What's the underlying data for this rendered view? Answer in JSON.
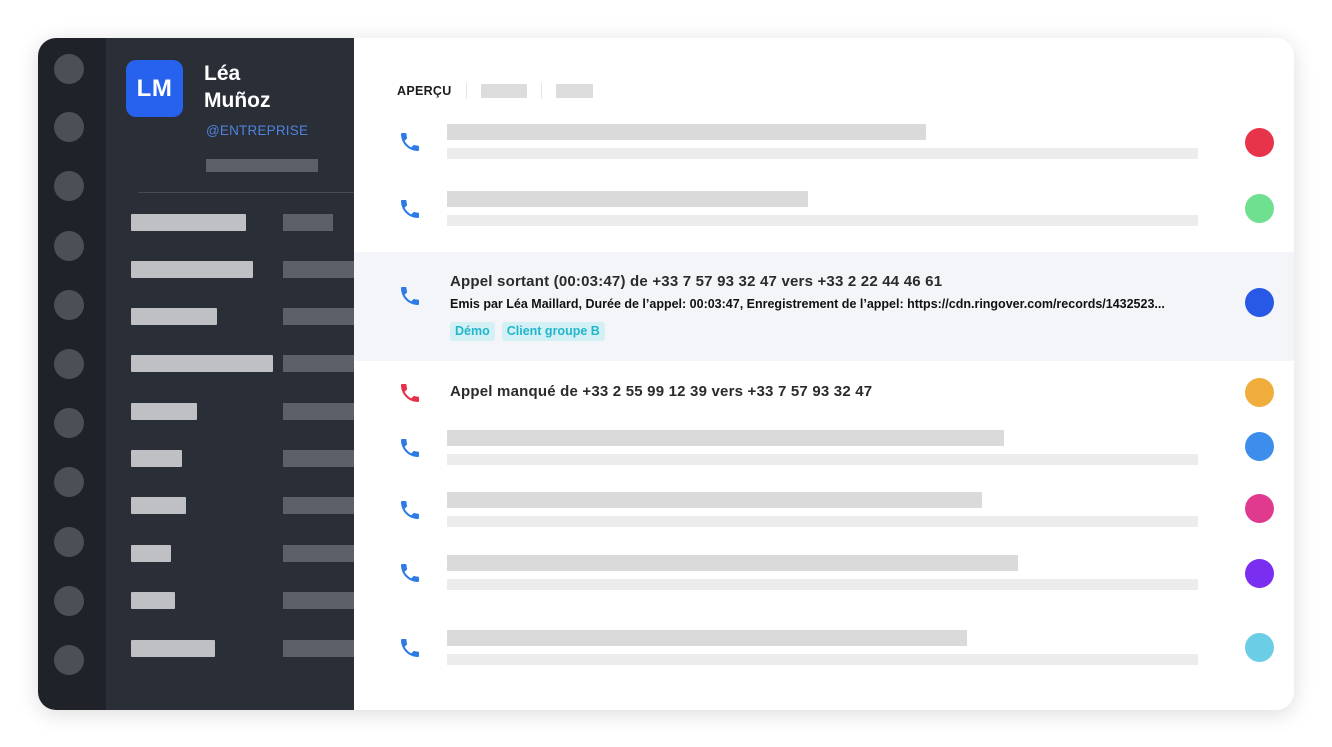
{
  "user": {
    "initials": "LM",
    "first_name": "Léa",
    "last_name": "Muñoz",
    "handle": "@ENTREPRISE"
  },
  "tabs": {
    "active": "APERÇU"
  },
  "calls": {
    "outgoing": {
      "title": "Appel sortant (00:03:47) de +33 7 57 93 32 47 vers +33 2 22 44 46 61",
      "description": "Emis par Léa Maillard, Durée de l’appel: 00:03:47, Enregistrement de l’appel: https://cdn.ringover.com/records/1432523...",
      "tags": [
        "Démo",
        "Client groupe B"
      ]
    },
    "missed": {
      "title": "Appel manqué de +33 2 55 99 12 39 vers +33 7 57 93 32 47"
    }
  },
  "icons": {
    "call": "phone-icon",
    "missed_call": "phone-icon"
  },
  "colors": {
    "brand_blue": "#2762ee",
    "phone_blue": "#2f7be6",
    "phone_red": "#e8304a",
    "tag_bg": "#d3f1f5",
    "tag_text": "#22b5cc",
    "dot_1": "#e8344a",
    "dot_2": "#6ee08f",
    "dot_3": "#2759e6",
    "dot_4": "#f0ad3c",
    "dot_5": "#3d8ded",
    "dot_6": "#e03a8f",
    "dot_7": "#7a2ff0",
    "dot_8": "#6bcde6"
  }
}
